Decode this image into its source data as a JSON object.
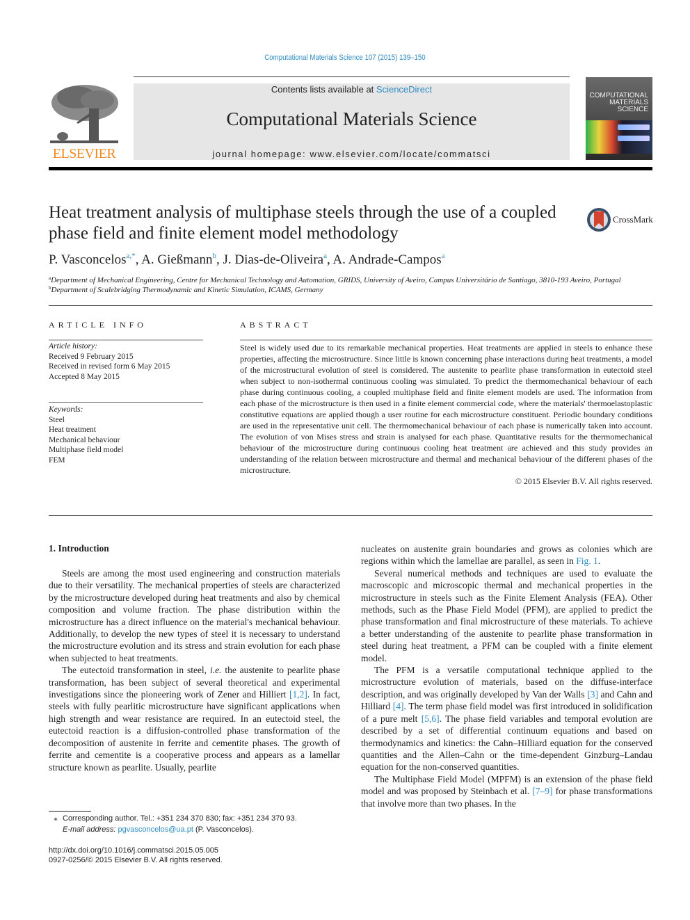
{
  "journal_header": {
    "citation": "Computational Materials Science 107 (2015) 139–150",
    "contents_prefix": "Contents lists available at ",
    "contents_link": "ScienceDirect",
    "journal_title": "Computational Materials Science",
    "homepage_label": "journal homepage: ",
    "homepage_url": "www.elsevier.com/locate/commatsci",
    "publisher_logo_text": "ELSEVIER",
    "cover_title_lines": [
      "COMPUTATIONAL",
      "MATERIALS",
      "SCIENCE"
    ],
    "colors": {
      "link": "#2e8bc0",
      "elsevier_orange": "#f08a24",
      "banner_bg": "#e6e6e6"
    }
  },
  "article": {
    "title": "Heat treatment analysis of multiphase steels through the use of a coupled phase field and finite element model methodology",
    "crossmark_label": "CrossMark",
    "authors": [
      {
        "name": "P. Vasconcelos",
        "affil": "a,",
        "corresponding": "*",
        "sep": ", "
      },
      {
        "name": "A. Gießmann",
        "affil": "b",
        "corresponding": "",
        "sep": ", "
      },
      {
        "name": "J. Dias-de-Oliveira",
        "affil": "a",
        "corresponding": "",
        "sep": ", "
      },
      {
        "name": "A. Andrade-Campos",
        "affil": "a",
        "corresponding": "",
        "sep": ""
      }
    ],
    "affiliations": [
      {
        "mark": "a",
        "text": "Department of Mechanical Engineering, Centre for Mechanical Technology and Automation, GRIDS, University of Aveiro, Campus Universitário de Santiago, 3810-193 Aveiro, Portugal"
      },
      {
        "mark": "b",
        "text": "Department of Scalebridging Thermodynamic and Kinetic Simulation, ICAMS, Germany"
      }
    ]
  },
  "article_info": {
    "heading": "ARTICLE INFO",
    "history_label": "Article history:",
    "history": [
      "Received 9 February 2015",
      "Received in revised form 6 May 2015",
      "Accepted 8 May 2015"
    ],
    "keywords_label": "Keywords:",
    "keywords": [
      "Steel",
      "Heat treatment",
      "Mechanical behaviour",
      "Multiphase field model",
      "FEM"
    ]
  },
  "abstract": {
    "heading": "ABSTRACT",
    "text": "Steel is widely used due to its remarkable mechanical properties. Heat treatments are applied in steels to enhance these properties, affecting the microstructure. Since little is known concerning phase interactions during heat treatments, a model of the microstructural evolution of steel is considered. The austenite to pearlite phase transformation in eutectoid steel when subject to non-isothermal continuous cooling was simulated. To predict the thermomechanical behaviour of each phase during continuous cooling, a coupled multiphase field and finite element models are used. The information from each phase of the microstructure is then used in a finite element commercial code, where the materials' thermoelastoplastic constitutive equations are applied though a user routine for each microstructure constituent. Periodic boundary conditions are used in the representative unit cell. The thermomechanical behaviour of each phase is numerically taken into account. The evolution of von Mises stress and strain is analysed for each phase. Quantitative results for the thermomechanical behaviour of the microstructure during continuous cooling heat treatment are achieved and this study provides an understanding of the relation between microstructure and thermal and mechanical behaviour of the different phases of the microstructure.",
    "copyright": "© 2015 Elsevier B.V. All rights reserved."
  },
  "body": {
    "section_heading": "1. Introduction",
    "left_col": {
      "p1": "Steels are among the most used engineering and construction materials due to their versatility. The mechanical properties of steels are characterized by the microstructure developed during heat treatments and also by chemical composition and volume fraction. The phase distribution within the microstructure has a direct influence on the material's mechanical behaviour. Additionally, to develop the new types of steel it is necessary to understand the microstructure evolution and its stress and strain evolution for each phase when subjected to heat treatments.",
      "p2_a": "The eutectoid transformation in steel, ",
      "p2_ie": "i.e.",
      "p2_b": " the austenite to pearlite phase transformation, has been subject of several theoretical and experimental investigations since the pioneering work of Zener and Hilliert ",
      "p2_ref": "[1,2]",
      "p2_c": ". In fact, steels with fully pearlitic microstructure have significant applications when high strength and wear resistance are required. In an eutectoid steel, the eutectoid reaction is a diffusion-controlled phase transformation of the decomposition of austenite in ferrite and cementite phases. The growth of ferrite and cementite is a cooperative process and appears as a lamellar structure known as pearlite. Usually, pearlite"
    },
    "right_col": {
      "p1_a": "nucleates on austenite grain boundaries and grows as colonies which are regions within which the lamellae are parallel, as seen in ",
      "p1_ref": "Fig. 1",
      "p1_b": ".",
      "p2": "Several numerical methods and techniques are used to evaluate the macroscopic and microscopic thermal and mechanical properties in the microstructure in steels such as the Finite Element Analysis (FEA). Other methods, such as the Phase Field Model (PFM), are applied to predict the phase transformation and final microstructure of these materials. To achieve a better understanding of the austenite to pearlite phase transformation in steel during heat treatment, a PFM can be coupled with a finite element model.",
      "p3_a": "The PFM is a versatile computational technique applied to the microstructure evolution of materials, based on the diffuse-interface description, and was originally developed by Van der Walls ",
      "p3_ref1": "[3]",
      "p3_b": " and Cahn and Hilliard ",
      "p3_ref2": "[4]",
      "p3_c": ". The term phase field model was first introduced in solidification of a pure melt ",
      "p3_ref3": "[5,6]",
      "p3_d": ". The phase field variables and temporal evolution are described by a set of differential continuum equations and based on thermodynamics and kinetics: the Cahn–Hilliard equation for the conserved quantities and the Allen–Cahn or the time-dependent Ginzburg–Landau equation for the non-conserved quantities.",
      "p4_a": "The Multiphase Field Model (MPFM) is an extension of the phase field model and was proposed by Steinbach et al. ",
      "p4_ref": "[7–9]",
      "p4_b": " for phase transformations that involve more than two phases. In the"
    }
  },
  "footnotes": {
    "corresponding_mark": "⁎",
    "corresponding_text": "Corresponding author. Tel.: +351 234 370 830; fax: +351 234 370 93.",
    "email_label": "E-mail address: ",
    "email": "pgvasconcelos@ua.pt",
    "email_suffix": " (P. Vasconcelos).",
    "doi": "http://dx.doi.org/10.1016/j.commatsci.2015.05.005",
    "issn_copyright": "0927-0256/© 2015 Elsevier B.V. All rights reserved."
  }
}
